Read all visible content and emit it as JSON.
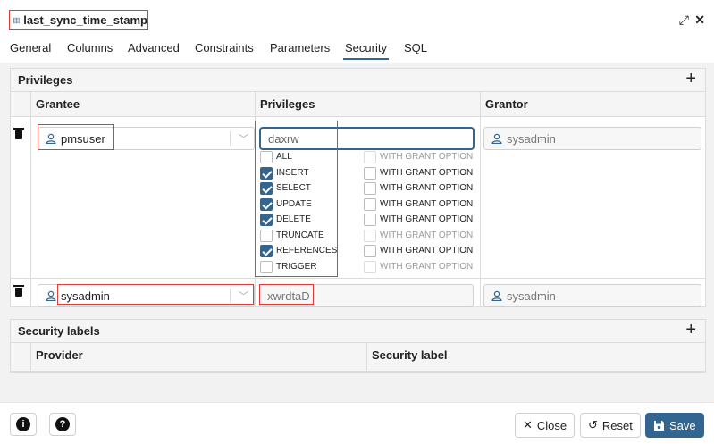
{
  "dialog": {
    "title": "last_sync_time_stamp",
    "expand_glyph": "⤢",
    "close_glyph": "✕"
  },
  "tabs": [
    {
      "label": "General"
    },
    {
      "label": "Columns"
    },
    {
      "label": "Advanced"
    },
    {
      "label": "Constraints"
    },
    {
      "label": "Parameters"
    },
    {
      "label": "Security",
      "active": true
    },
    {
      "label": "SQL"
    }
  ],
  "privileges_section": {
    "title": "Privileges",
    "add_glyph": "+",
    "columns": {
      "grantee": "Grantee",
      "privileges": "Privileges",
      "grantor": "Grantor"
    },
    "rows": [
      {
        "grantee": "pmsuser",
        "privileges": "daxrw",
        "grantor": "sysadmin",
        "options": [
          {
            "name": "ALL",
            "checked": false,
            "grant": "WITH GRANT OPTION",
            "grant_enabled": false
          },
          {
            "name": "INSERT",
            "checked": true,
            "grant": "WITH GRANT OPTION",
            "grant_enabled": true
          },
          {
            "name": "SELECT",
            "checked": true,
            "grant": "WITH GRANT OPTION",
            "grant_enabled": true
          },
          {
            "name": "UPDATE",
            "checked": true,
            "grant": "WITH GRANT OPTION",
            "grant_enabled": true
          },
          {
            "name": "DELETE",
            "checked": true,
            "grant": "WITH GRANT OPTION",
            "grant_enabled": true
          },
          {
            "name": "TRUNCATE",
            "checked": false,
            "grant": "WITH GRANT OPTION",
            "grant_enabled": false
          },
          {
            "name": "REFERENCES",
            "checked": true,
            "grant": "WITH GRANT OPTION",
            "grant_enabled": true
          },
          {
            "name": "TRIGGER",
            "checked": false,
            "grant": "WITH GRANT OPTION",
            "grant_enabled": false
          }
        ]
      },
      {
        "grantee": "sysadmin",
        "privileges": "xwrdtaD",
        "grantor": "sysadmin"
      }
    ]
  },
  "security_labels_section": {
    "title": "Security labels",
    "add_glyph": "+",
    "columns": {
      "provider": "Provider",
      "security_label": "Security label"
    }
  },
  "footer": {
    "info_glyph": "i",
    "help_glyph": "?",
    "close_label": "Close",
    "reset_label": "Reset",
    "save_label": "Save"
  },
  "colors": {
    "accent": "#326690",
    "highlight_box": "#e03a3a"
  }
}
